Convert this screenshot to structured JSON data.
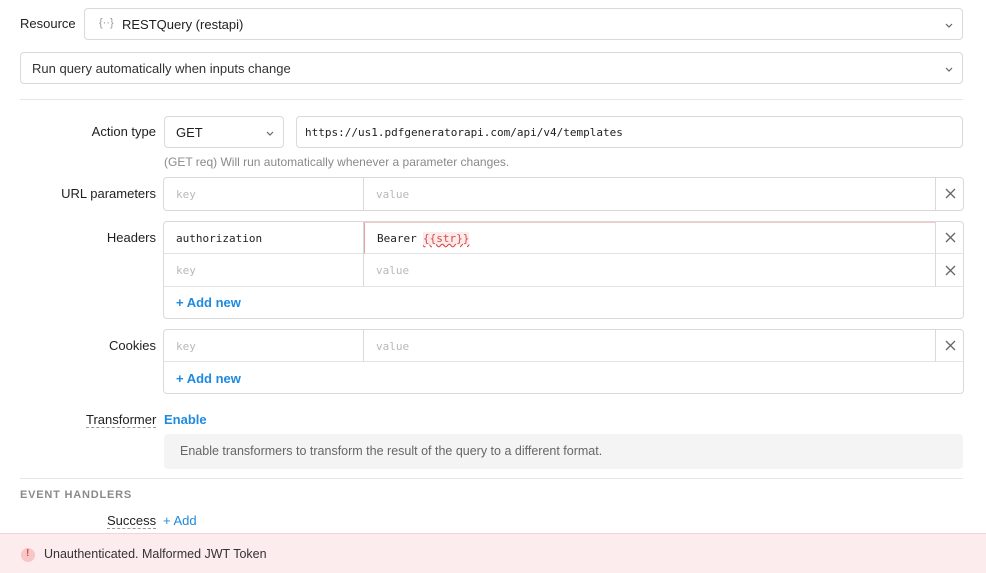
{
  "resource": {
    "label": "Resource",
    "value": "RESTQuery (restapi)",
    "icon": "braces-icon"
  },
  "run_mode": {
    "value": "Run query automatically when inputs change"
  },
  "action": {
    "label": "Action type",
    "method": "GET",
    "url": "https://us1.pdfgeneratorapi.com/api/v4/templates",
    "hint": "(GET req) Will run automatically whenever a parameter changes."
  },
  "url_params": {
    "label": "URL parameters",
    "key_placeholder": "key",
    "value_placeholder": "value"
  },
  "headers": {
    "label": "Headers",
    "rows": [
      {
        "key": "authorization",
        "value_prefix": "Bearer ",
        "value_template": "{{str}}"
      }
    ],
    "key_placeholder": "key",
    "value_placeholder": "value",
    "add_new": "+ Add new"
  },
  "cookies": {
    "label": "Cookies",
    "key_placeholder": "key",
    "value_placeholder": "value",
    "add_new": "+ Add new"
  },
  "transformer": {
    "label": "Transformer",
    "enable": "Enable",
    "description": "Enable transformers to transform the result of the query to a different format."
  },
  "event_handlers": {
    "title": "EVENT HANDLERS",
    "success_label": "Success",
    "add": "+ Add"
  },
  "error": {
    "icon": "!",
    "message": "Unauthenticated. Malformed JWT Token",
    "color": "#fdeced"
  }
}
